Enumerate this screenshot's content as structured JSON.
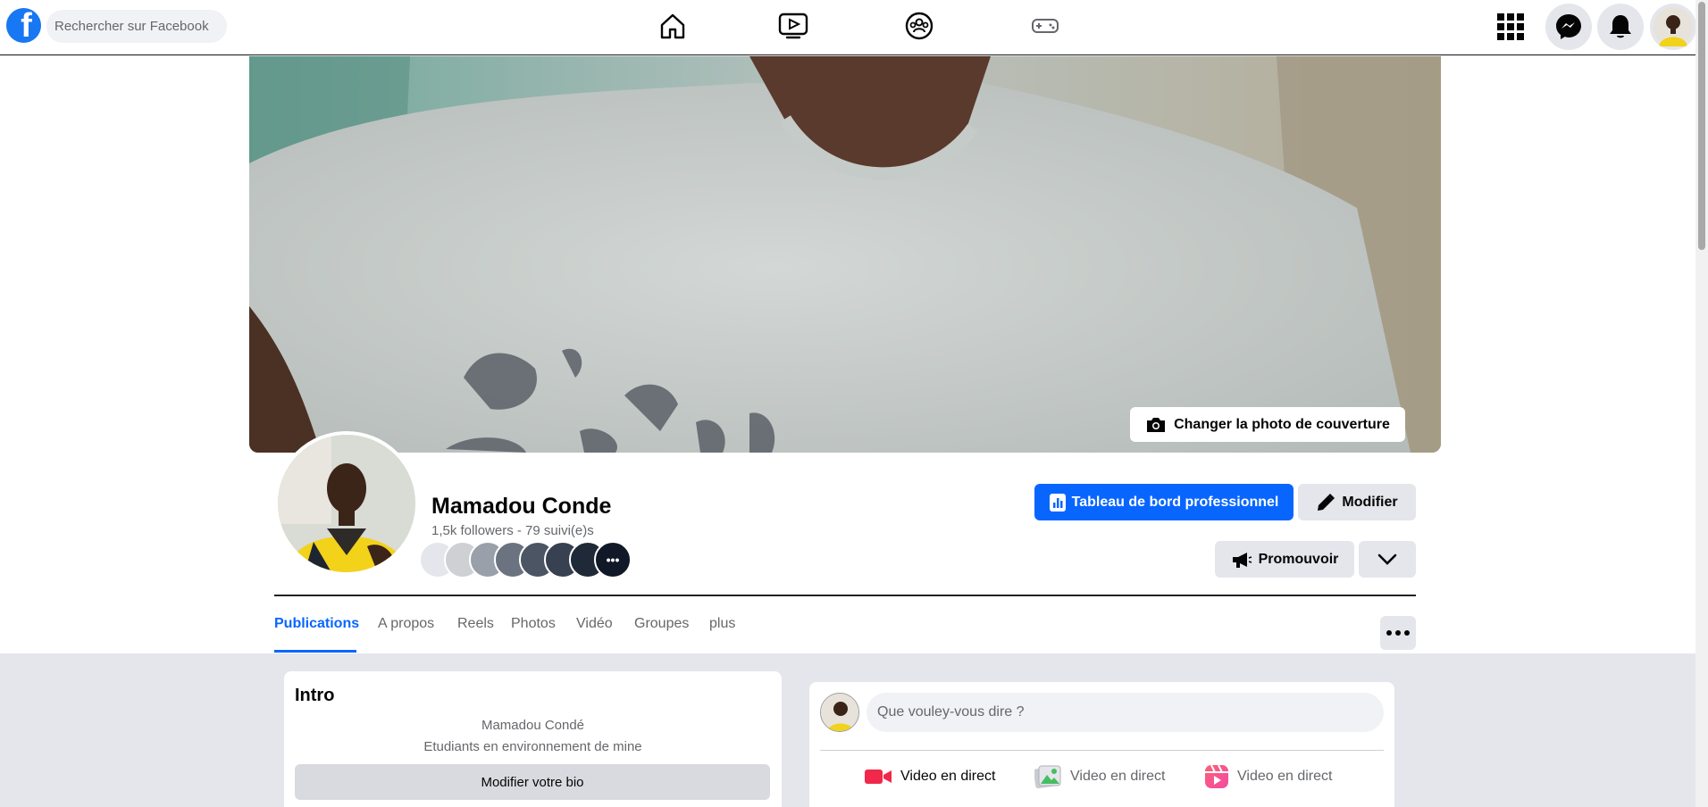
{
  "topbar": {
    "logo_letter": "f",
    "search_placeholder": "Rechercher sur Facebook",
    "nav": [
      {
        "name": "home-icon"
      },
      {
        "name": "watch-icon"
      },
      {
        "name": "groups-icon"
      },
      {
        "name": "gaming-icon"
      }
    ],
    "right": [
      {
        "name": "menu-grid-icon"
      },
      {
        "name": "messenger-icon"
      },
      {
        "name": "notifications-icon"
      },
      {
        "name": "account-avatar"
      }
    ]
  },
  "cover": {
    "change_cover_label": "Changer la photo de couverture"
  },
  "profile": {
    "name": "Mamadou Conde",
    "stats": "1,5k followers - 79 suivi(e)s",
    "more_followers": "•••"
  },
  "actions": {
    "dashboard_label": "Tableau de bord professionnel",
    "edit_label": "Modifier",
    "promote_label": "Promouvoir"
  },
  "tabs": [
    {
      "label": "Publications",
      "active": true
    },
    {
      "label": "A propos"
    },
    {
      "label": "Reels"
    },
    {
      "label": "Photos"
    },
    {
      "label": "Vidéo"
    },
    {
      "label": "Groupes"
    },
    {
      "label": "plus"
    }
  ],
  "intro": {
    "title": "Intro",
    "name_line": "Mamadou Condé",
    "bio_line": "Etudiants en environnement de mine",
    "edit_bio_label": "Modifier votre bio"
  },
  "composer": {
    "placeholder": "Que vouley-vous dire ?",
    "actions": [
      {
        "label": "Video en direct",
        "icon": "live-video-icon"
      },
      {
        "label": "Video en direct",
        "icon": "photo-video-icon"
      },
      {
        "label": "Video en direct",
        "icon": "reel-icon"
      }
    ]
  },
  "colors": {
    "brand_blue": "#0866ff",
    "facebook_blue": "#1877f2",
    "live_red": "#f02849"
  }
}
